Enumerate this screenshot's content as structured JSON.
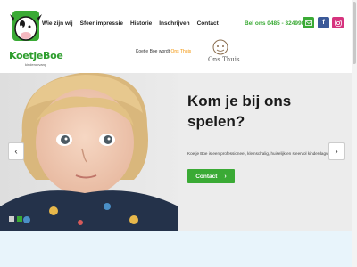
{
  "logo": {
    "name_part1": "Koetje",
    "name_part2": "Boe",
    "subtitle": "kinderopvang"
  },
  "nav": {
    "items": [
      {
        "label": "Wie zijn wij"
      },
      {
        "label": "Sfeer impressie"
      },
      {
        "label": "Historie"
      },
      {
        "label": "Inschrijven"
      },
      {
        "label": "Contact"
      }
    ]
  },
  "header": {
    "phone": "Bel ons 0485 - 324990",
    "social": {
      "mail_icon": "mail-icon",
      "facebook_glyph": "f",
      "instagram_icon": "instagram-icon"
    },
    "onsthuis_prefix": "Koetje Boe wordt",
    "onsthuis_link": "Ons Thuis",
    "onsthuis_logo_text": "Ons Thuis"
  },
  "hero": {
    "title": "Kom je bij ons spelen?",
    "text": "Koetje Boe is een professioneel, kleinschalig, huiselijk en sfeervol kinderdagverblijf.",
    "button_label": "Contact",
    "prev_glyph": "‹",
    "next_glyph": "›",
    "slides": 2,
    "active_slide": 2
  },
  "colors": {
    "brand_green": "#3aaa35",
    "accent_orange": "#f39200",
    "facebook_blue": "#3b5998",
    "instagram_pink": "#d6337e"
  }
}
